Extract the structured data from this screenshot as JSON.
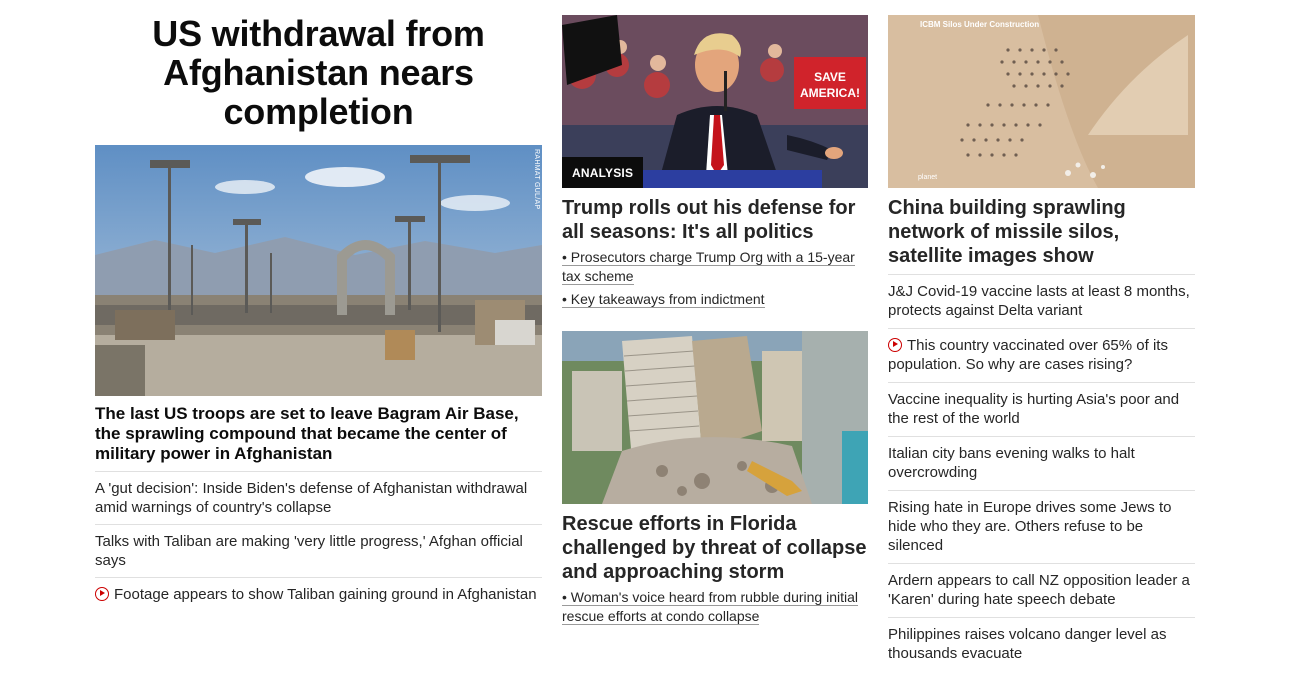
{
  "lead": {
    "title": "US withdrawal from Afghanistan nears completion",
    "image_credit": "RAHMAT GUL/AP",
    "headline": "The last US troops are set to leave Bagram Air Base, the sprawling compound that became the center of military power in Afghanistan",
    "links": [
      {
        "text": "A 'gut decision': Inside Biden's defense of Afghanistan withdrawal amid warnings of country's collapse",
        "video": false
      },
      {
        "text": "Talks with Taliban are making 'very little progress,' Afghan official says",
        "video": false
      },
      {
        "text": "Footage appears to show Taliban gaining ground in Afghanistan",
        "video": true
      }
    ]
  },
  "trump": {
    "badge": "ANALYSIS",
    "headline": "Trump rolls out his defense for all seasons: It's all politics",
    "bullets": [
      "• Prosecutors charge Trump Org with a 15-year tax scheme",
      "• Key takeaways from indictment"
    ]
  },
  "florida": {
    "headline": "Rescue efforts in Florida challenged by threat of collapse and approaching storm",
    "bullets": [
      "• Woman's voice heard from rubble during initial rescue efforts at condo collapse"
    ]
  },
  "china": {
    "image_caption": "ICBM Silos Under Construction",
    "image_brand": "planet",
    "headline": "China building sprawling network of missile silos, satellite images show",
    "links": [
      {
        "text": "J&J Covid-19 vaccine lasts at least 8 months, protects against Delta variant",
        "video": false
      },
      {
        "text": "This country vaccinated over 65% of its population. So why are cases rising?",
        "video": true
      },
      {
        "text": "Vaccine inequality is hurting Asia's poor and the rest of the world",
        "video": false
      },
      {
        "text": "Italian city bans evening walks to halt overcrowding",
        "video": false
      },
      {
        "text": "Rising hate in Europe drives some Jews to hide who they are. Others refuse to be silenced",
        "video": false
      },
      {
        "text": "Ardern appears to call NZ opposition leader a 'Karen' during hate speech debate",
        "video": false
      },
      {
        "text": "Philippines raises volcano danger level as thousands evacuate",
        "video": false
      }
    ]
  },
  "colors": {
    "accent_red": "#cc0000",
    "text": "#0c0c0c",
    "divider": "#e0e0e0"
  }
}
